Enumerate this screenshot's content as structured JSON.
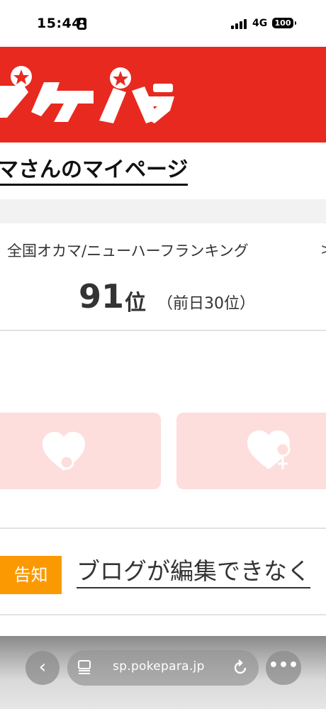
{
  "status_bar": {
    "time": "15:44",
    "network": "4G",
    "battery": "100"
  },
  "header": {
    "logo_text": "ポケパラ",
    "brand_color": "#e8291f"
  },
  "page": {
    "title": "マさんのマイページ"
  },
  "ranking": {
    "label": "全国オカマ/ニューハーフランキング",
    "chevron": ">",
    "rank": "91",
    "unit": "位",
    "previous": "（前日30位）"
  },
  "gender_buttons": [
    {
      "icon": "heart-male-icon",
      "color": "#fddedc"
    },
    {
      "icon": "heart-female-icon",
      "color": "#fddedc"
    }
  ],
  "notice": {
    "badge": "告知",
    "text": "ブログが編集できなく",
    "badge_color": "#fb9902"
  },
  "browser": {
    "back": "‹",
    "url": "sp.pokepara.jp",
    "more": "•••"
  }
}
